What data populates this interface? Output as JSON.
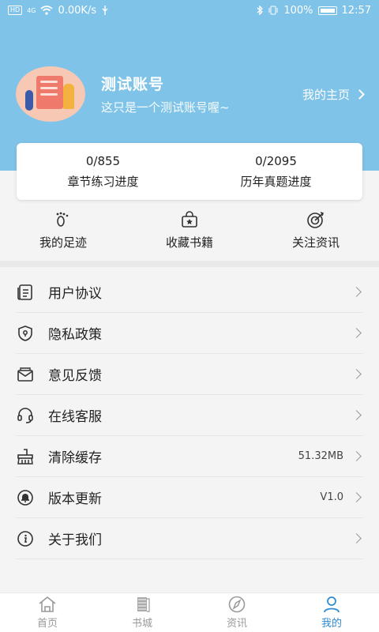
{
  "status_bar": {
    "network_badge": "HD",
    "signal_tag": "4G",
    "speed": "0.00K/s",
    "battery": "100%",
    "time": "12:57"
  },
  "profile": {
    "name": "测试账号",
    "description": "这只是一个测试账号喔~",
    "homepage_link": "我的主页"
  },
  "progress": [
    {
      "value": "0/855",
      "label": "章节练习进度"
    },
    {
      "value": "0/2095",
      "label": "历年真题进度"
    }
  ],
  "quick_links": [
    {
      "label": "我的足迹",
      "icon": "footprint-icon"
    },
    {
      "label": "收藏书籍",
      "icon": "bookmark-bag-icon"
    },
    {
      "label": "关注资讯",
      "icon": "target-icon"
    }
  ],
  "menu": [
    {
      "label": "用户协议",
      "icon": "document-icon",
      "value": ""
    },
    {
      "label": "隐私政策",
      "icon": "shield-icon",
      "value": ""
    },
    {
      "label": "意见反馈",
      "icon": "mail-icon",
      "value": ""
    },
    {
      "label": "在线客服",
      "icon": "headset-icon",
      "value": ""
    },
    {
      "label": "清除缓存",
      "icon": "broom-icon",
      "value": "51.32MB"
    },
    {
      "label": "版本更新",
      "icon": "bell-icon",
      "value": "V1.0"
    },
    {
      "label": "关于我们",
      "icon": "info-icon",
      "value": ""
    }
  ],
  "bottom_nav": [
    {
      "label": "首页",
      "icon": "home-icon",
      "active": false
    },
    {
      "label": "书城",
      "icon": "books-icon",
      "active": false
    },
    {
      "label": "资讯",
      "icon": "compass-icon",
      "active": false
    },
    {
      "label": "我的",
      "icon": "user-icon",
      "active": true
    }
  ],
  "colors": {
    "header_bg": "#7fc3e8",
    "accent": "#2e8bd0"
  }
}
